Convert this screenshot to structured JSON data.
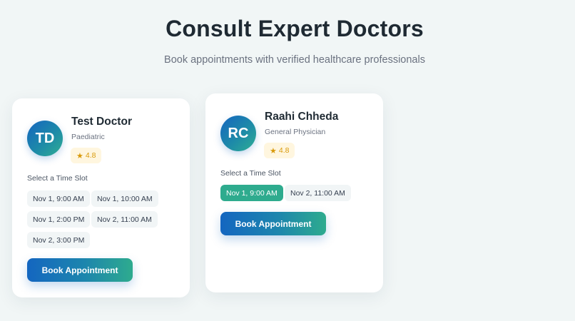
{
  "header": {
    "title": "Consult Expert Doctors",
    "subtitle": "Book appointments with verified healthcare professionals"
  },
  "colors": {
    "background": "#f1f6f6",
    "primary_gradient_start": "#1466c0",
    "primary_gradient_end": "#2eab8e",
    "selected_slot": "#2eab8e",
    "rating_bg": "#fff6df",
    "rating_text": "#d99a0b"
  },
  "doctors": [
    {
      "initials": "TD",
      "name": "Test Doctor",
      "specialty": "Paediatric",
      "rating_icon": "star-icon",
      "rating": "4.8",
      "slot_label": "Select a Time Slot",
      "slots": [
        {
          "label": "Nov 1, 9:00 AM",
          "selected": false
        },
        {
          "label": "Nov 1, 10:00 AM",
          "selected": false
        },
        {
          "label": "Nov 1, 2:00 PM",
          "selected": false
        },
        {
          "label": "Nov 2, 11:00 AM",
          "selected": false
        },
        {
          "label": "Nov 2, 3:00 PM",
          "selected": false
        }
      ],
      "book_label": "Book Appointment"
    },
    {
      "initials": "RC",
      "name": "Raahi Chheda",
      "specialty": "General Physician",
      "rating_icon": "star-icon",
      "rating": "4.8",
      "slot_label": "Select a Time Slot",
      "slots": [
        {
          "label": "Nov 1, 9:00 AM",
          "selected": true
        },
        {
          "label": "Nov 2, 11:00 AM",
          "selected": false
        }
      ],
      "book_label": "Book Appointment"
    }
  ]
}
